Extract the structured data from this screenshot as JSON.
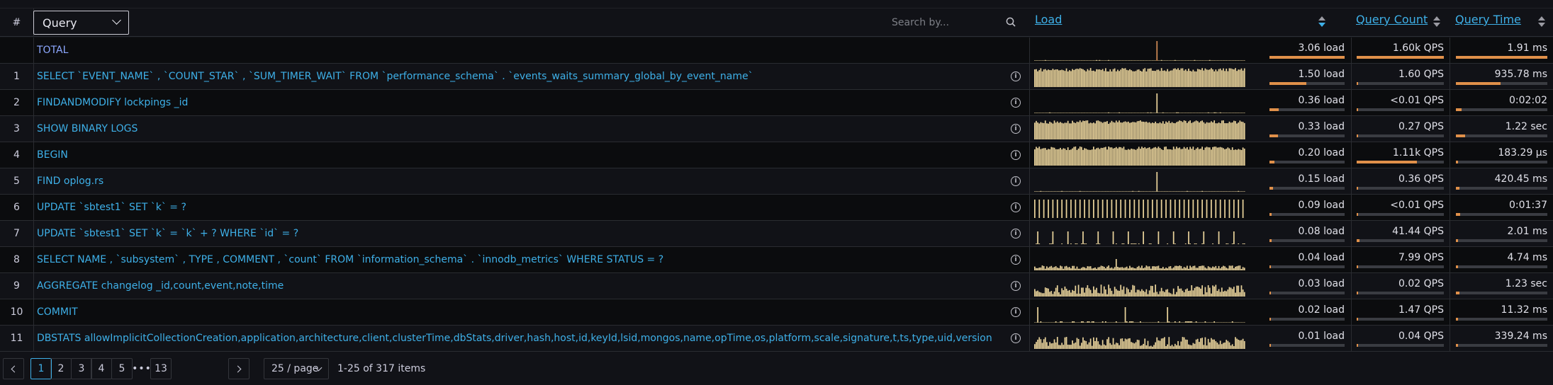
{
  "header": {
    "num_label": "#",
    "query_select": "Query",
    "search_placeholder": "Search by...",
    "load_label": "Load",
    "query_count_label": "Query Count",
    "query_time_label": "Query Time"
  },
  "total": {
    "label": "TOTAL",
    "load": "3.06 load",
    "load_fraction": 1.0,
    "qps": "1.60k QPS",
    "qps_fraction": 1.0,
    "time": "1.91 ms",
    "time_fraction": 1.0,
    "spark": "spike"
  },
  "rows": [
    {
      "num": "1",
      "query": "SELECT `EVENT_NAME` , `COUNT_STAR` , `SUM_TIMER_WAIT` FROM `performance_schema` . `events_waits_summary_global_by_event_name`",
      "load": "1.50 load",
      "load_fraction": 0.49,
      "qps": "1.60 QPS",
      "qps_fraction": 0.01,
      "time": "935.78 ms",
      "time_fraction": 0.49,
      "spark": "dense"
    },
    {
      "num": "2",
      "query": "FINDANDMODIFY lockpings _id",
      "load": "0.36 load",
      "load_fraction": 0.12,
      "qps": "<0.01 QPS",
      "qps_fraction": 0.0,
      "time": "0:02:02",
      "time_fraction": 0.06,
      "spark": "spike"
    },
    {
      "num": "3",
      "query": "SHOW BINARY LOGS",
      "load": "0.33 load",
      "load_fraction": 0.11,
      "qps": "0.27 QPS",
      "qps_fraction": 0.0,
      "time": "1.22 sec",
      "time_fraction": 0.1,
      "spark": "dense"
    },
    {
      "num": "4",
      "query": "BEGIN",
      "load": "0.20 load",
      "load_fraction": 0.07,
      "qps": "1.11k QPS",
      "qps_fraction": 0.69,
      "time": "183.29 µs",
      "time_fraction": 0.02,
      "spark": "dense"
    },
    {
      "num": "5",
      "query": "FIND oplog.rs",
      "load": "0.15 load",
      "load_fraction": 0.05,
      "qps": "0.36 QPS",
      "qps_fraction": 0.0,
      "time": "420.45 ms",
      "time_fraction": 0.04,
      "spark": "spike"
    },
    {
      "num": "6",
      "query": "UPDATE `sbtest1` SET `k` = ?",
      "load": "0.09 load",
      "load_fraction": 0.03,
      "qps": "<0.01 QPS",
      "qps_fraction": 0.0,
      "time": "0:01:37",
      "time_fraction": 0.05,
      "spark": "comb"
    },
    {
      "num": "7",
      "query": "UPDATE `sbtest1` SET `k` = `k` + ? WHERE `id` = ?",
      "load": "0.08 load",
      "load_fraction": 0.03,
      "qps": "41.44 QPS",
      "qps_fraction": 0.03,
      "time": "2.01 ms",
      "time_fraction": 0.02,
      "spark": "sparse"
    },
    {
      "num": "8",
      "query": "SELECT NAME , `subsystem` , TYPE , COMMENT , `count` FROM `information_schema` . `innodb_metrics` WHERE STATUS = ?",
      "load": "0.04 load",
      "load_fraction": 0.01,
      "qps": "7.99 QPS",
      "qps_fraction": 0.01,
      "time": "4.74 ms",
      "time_fraction": 0.02,
      "spark": "low"
    },
    {
      "num": "9",
      "query": "AGGREGATE changelog _id,count,event,note,time",
      "load": "0.03 load",
      "load_fraction": 0.01,
      "qps": "0.02 QPS",
      "qps_fraction": 0.0,
      "time": "1.23 sec",
      "time_fraction": 0.04,
      "spark": "noisy"
    },
    {
      "num": "10",
      "query": "COMMIT",
      "load": "0.02 load",
      "load_fraction": 0.01,
      "qps": "1.47 QPS",
      "qps_fraction": 0.0,
      "time": "11.32 ms",
      "time_fraction": 0.02,
      "spark": "sparse2"
    },
    {
      "num": "11",
      "query": "DBSTATS allowImplicitCollectionCreation,application,architecture,client,clusterTime,dbStats,driver,hash,host,id,keyId,lsid,mongos,name,opTime,os,platform,scale,signature,t,ts,type,uid,version",
      "load": "0.01 load",
      "load_fraction": 0.0,
      "qps": "0.04 QPS",
      "qps_fraction": 0.0,
      "time": "339.24 ms",
      "time_fraction": 0.02,
      "spark": "noisy"
    }
  ],
  "pagination": {
    "pages": [
      "1",
      "2",
      "3",
      "4",
      "5"
    ],
    "dots": "•••",
    "last": "13",
    "active": "1",
    "page_size": "25 / page",
    "items_text": "1-25 of 317 items"
  },
  "colors": {
    "link": "#3eb0e8",
    "bar_fill": "#e0904a",
    "spark_fill": "#e8d29a",
    "spike": "#d08a55"
  }
}
